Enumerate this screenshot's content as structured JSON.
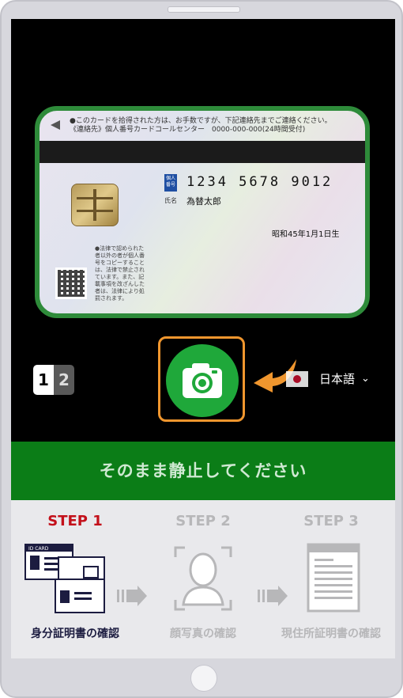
{
  "card": {
    "notice": "●このカードを拾得された方は、お手数ですが、下記連絡先までご連絡ください。\n《連絡先》個人番号カードコールセンター　0000-000-000(24時間受付)",
    "number_tag": "個人番号",
    "number": "1234 5678 9012",
    "name_label": "氏名",
    "name": "為替太郎",
    "dob": "昭和45年1月1日生",
    "legal_note": "●法律で認められた者以外の者が個人番号をコピーすることは、法律で禁止されています。また、記載事項を改ざんした者は、法律により処罰されます。"
  },
  "page_indicator": {
    "current": "1",
    "next": "2"
  },
  "camera": {
    "icon": "camera-icon"
  },
  "language": {
    "label": "日本語",
    "caret": "⌄"
  },
  "banner": {
    "text": "そのまま静止してください"
  },
  "steps": [
    {
      "title": "STEP 1",
      "label": "身分証明書の確認",
      "icon": "id-card-icon",
      "status": "active"
    },
    {
      "title": "STEP 2",
      "label": "顔写真の確認",
      "icon": "face-scan-icon",
      "status": "inactive"
    },
    {
      "title": "STEP 3",
      "label": "現住所証明書の確認",
      "icon": "document-icon",
      "status": "inactive"
    }
  ],
  "colors": {
    "accent": "#1fa83a",
    "banner": "#0b7d17",
    "highlight": "#f0962e",
    "step_active": "#c3101a"
  }
}
